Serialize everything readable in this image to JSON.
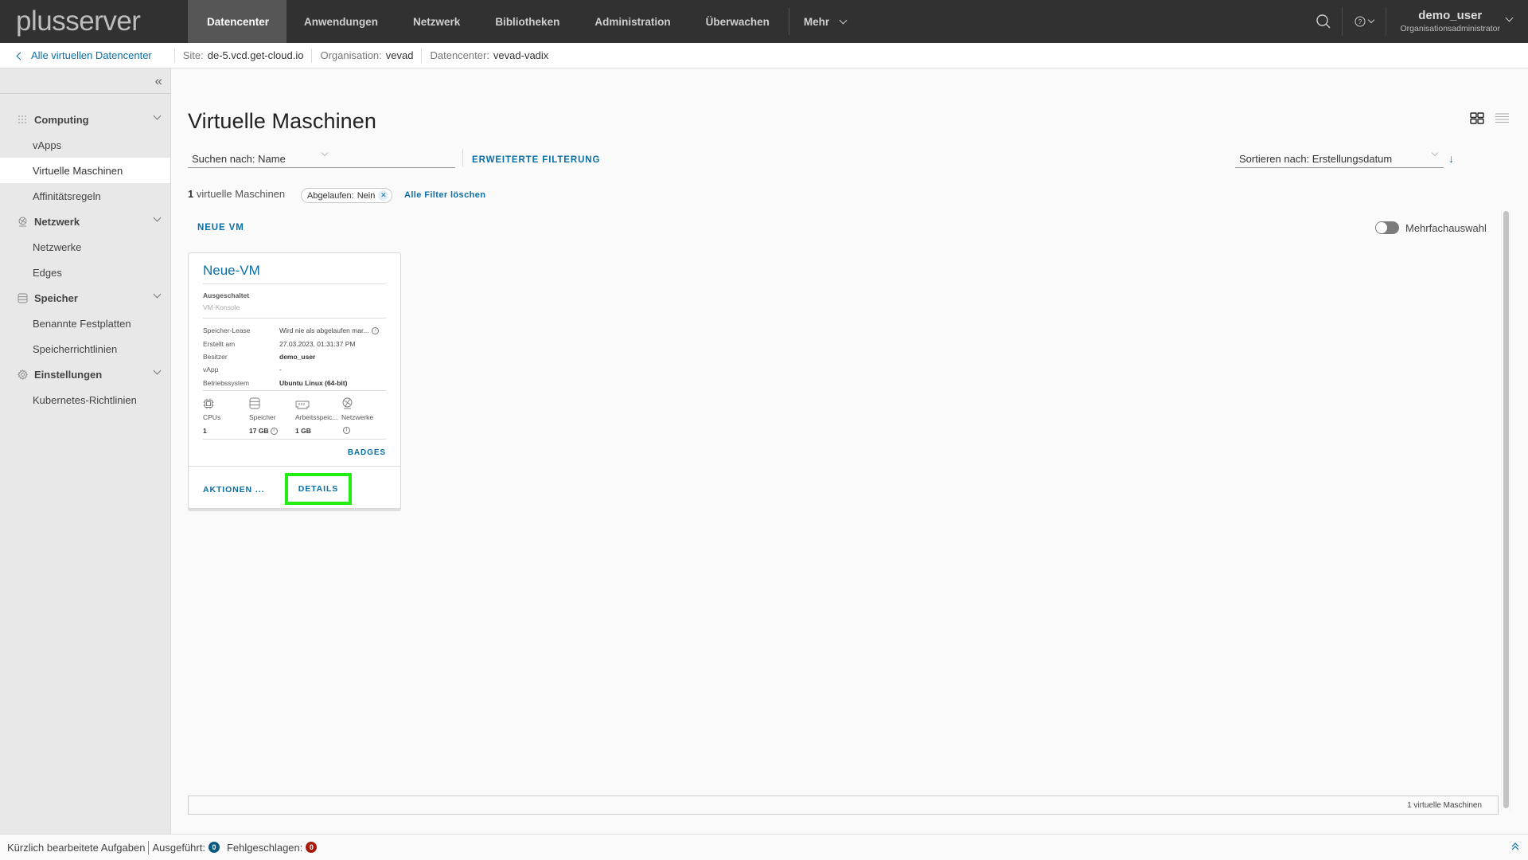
{
  "header": {
    "logo": "plusserver",
    "nav": [
      {
        "label": "Datencenter",
        "active": true
      },
      {
        "label": "Anwendungen"
      },
      {
        "label": "Netzwerk"
      },
      {
        "label": "Bibliotheken"
      },
      {
        "label": "Administration"
      },
      {
        "label": "Überwachen"
      }
    ],
    "more_label": "Mehr",
    "user": {
      "name": "demo_user",
      "role": "Organisationsadministrator"
    },
    "icons": {
      "search": "search-icon",
      "help": "help-circle-icon"
    }
  },
  "context": {
    "back_label": "Alle virtuellen Datencenter",
    "items": [
      {
        "label": "Site:",
        "value": "de-5.vcd.get-cloud.io"
      },
      {
        "label": "Organisation:",
        "value": "vevad"
      },
      {
        "label": "Datencenter:",
        "value": "vevad-vadix"
      }
    ]
  },
  "sidebar": {
    "collapse_icon": "double-chevron-left-icon",
    "groups": [
      {
        "label": "Computing",
        "icon": "grid-icon",
        "items": [
          {
            "label": "vApps"
          },
          {
            "label": "Virtuelle Maschinen",
            "active": true
          },
          {
            "label": "Affinitätsregeln"
          }
        ]
      },
      {
        "label": "Netzwerk",
        "icon": "network-globe-icon",
        "items": [
          {
            "label": "Netzwerke"
          },
          {
            "label": "Edges"
          }
        ]
      },
      {
        "label": "Speicher",
        "icon": "storage-icon",
        "items": [
          {
            "label": "Benannte Festplatten"
          },
          {
            "label": "Speicherrichtlinien"
          }
        ]
      },
      {
        "label": "Einstellungen",
        "icon": "gear-icon",
        "items": [
          {
            "label": "Kubernetes-Richtlinien"
          }
        ]
      }
    ]
  },
  "main": {
    "title": "Virtuelle Maschinen",
    "search": {
      "label": "Suchen nach:",
      "value": "Name"
    },
    "advanced_filter": "ERWEITERTE FILTERUNG",
    "sort": {
      "label": "Sortieren nach:",
      "value": "Erstellungsdatum",
      "direction": "descending"
    },
    "count": {
      "number": "1",
      "text": "virtuelle Maschinen"
    },
    "filter_chip": {
      "label": "Abgelaufen:",
      "value": "Nein"
    },
    "clear_filters": "Alle Filter löschen",
    "new_vm": "NEUE VM",
    "multi_select": {
      "label": "Mehrfachauswahl",
      "on": false
    },
    "footer_count": "1 virtuelle Maschinen"
  },
  "vm_card": {
    "name": "Neue-VM",
    "status": "Ausgeschaltet",
    "console": "VM-Konsole",
    "properties": [
      {
        "key": "Speicher-Lease",
        "value": "Wird nie als abgelaufen mar...",
        "info": true
      },
      {
        "key": "Erstellt am",
        "value": "27.03.2023, 01:31:37 PM"
      },
      {
        "key": "Besitzer",
        "value": "demo_user",
        "bold": true
      },
      {
        "key": "vApp",
        "value": "-"
      },
      {
        "key": "Betriebssystem",
        "value": "Ubuntu Linux (64-bit)",
        "bold": true
      }
    ],
    "resources": [
      {
        "label": "CPUs",
        "value": "1",
        "icon": "cpu-icon"
      },
      {
        "label": "Speicher",
        "value": "17 GB",
        "icon": "storage-icon",
        "info": true
      },
      {
        "label": "Arbeitsspeic...",
        "value": "1 GB",
        "icon": "memory-icon"
      },
      {
        "label": "Netzwerke",
        "value": "",
        "icon": "network-globe-icon",
        "info": true
      }
    ],
    "badges": "BADGES",
    "actions": "AKTIONEN ...",
    "details": "DETAILS"
  },
  "statusbar": {
    "recent_tasks": "Kürzlich bearbeitete Aufgaben",
    "executed": {
      "label": "Ausgeführt:",
      "count": "0",
      "color": "#0a5a80"
    },
    "failed": {
      "label": "Fehlgeschlagen:",
      "count": "0",
      "color": "#a61c0c"
    }
  }
}
